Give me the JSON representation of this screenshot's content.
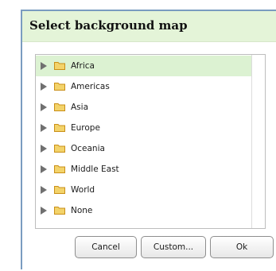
{
  "dialog": {
    "title": "Select background map"
  },
  "tree": {
    "items": [
      {
        "label": "Africa",
        "selected": true
      },
      {
        "label": "Americas",
        "selected": false
      },
      {
        "label": "Asia",
        "selected": false
      },
      {
        "label": "Europe",
        "selected": false
      },
      {
        "label": "Oceania",
        "selected": false
      },
      {
        "label": "Middle East",
        "selected": false
      },
      {
        "label": "World",
        "selected": false
      },
      {
        "label": "None",
        "selected": false
      }
    ],
    "expand_icon": "triangle-right-icon",
    "item_icon": "folder-icon"
  },
  "buttons": {
    "cancel_label": "Cancel",
    "custom_label": "Custom...",
    "ok_label": "Ok"
  },
  "colors": {
    "title_background": "#e4f4d8",
    "selected_row": "#dcf2d2",
    "folder_fill": "#f3d36a",
    "folder_stroke": "#c98f17",
    "dialog_border": "#7a9cc0"
  }
}
